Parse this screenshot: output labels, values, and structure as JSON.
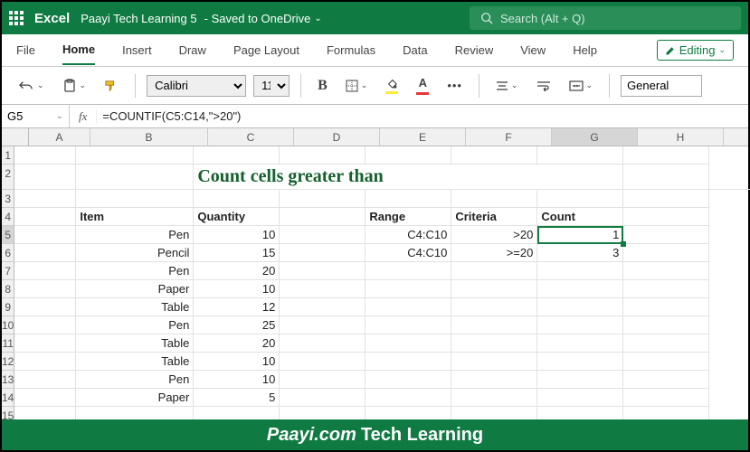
{
  "titlebar": {
    "app": "Excel",
    "doc": "Paayi Tech Learning 5",
    "saved": "- Saved to OneDrive",
    "search": "Search (Alt + Q)"
  },
  "tabs": {
    "file": "File",
    "home": "Home",
    "insert": "Insert",
    "draw": "Draw",
    "pagelayout": "Page Layout",
    "formulas": "Formulas",
    "data": "Data",
    "review": "Review",
    "view": "View",
    "help": "Help",
    "editing": "Editing"
  },
  "toolbar": {
    "font": "Calibri",
    "size": "11",
    "general": "General"
  },
  "formula": {
    "cellref": "G5",
    "fx": "fx",
    "text": "=COUNTIF(C5:C14,\">20\")"
  },
  "columns": [
    "A",
    "B",
    "C",
    "D",
    "E",
    "F",
    "G",
    "H"
  ],
  "rows": [
    "1",
    "2",
    "3",
    "4",
    "5",
    "6",
    "7",
    "8",
    "9",
    "10",
    "11",
    "12",
    "13",
    "14",
    "15"
  ],
  "sheet": {
    "title": "Count cells greater than",
    "h_item": "Item",
    "h_qty": "Quantity",
    "h_range": "Range",
    "h_crit": "Criteria",
    "h_count": "Count",
    "items": [
      "Pen",
      "Pencil",
      "Pen",
      "Paper",
      "Table",
      "Pen",
      "Table",
      "Table",
      "Pen",
      "Paper"
    ],
    "qtys": [
      "10",
      "15",
      "20",
      "10",
      "12",
      "25",
      "20",
      "10",
      "10",
      "5"
    ],
    "ranges": [
      "C4:C10",
      "C4:C10"
    ],
    "crits": [
      ">20",
      ">=20"
    ],
    "counts": [
      "1",
      "3"
    ]
  },
  "footer": {
    "a": "Paayi.com",
    "b": "Tech Learning"
  }
}
